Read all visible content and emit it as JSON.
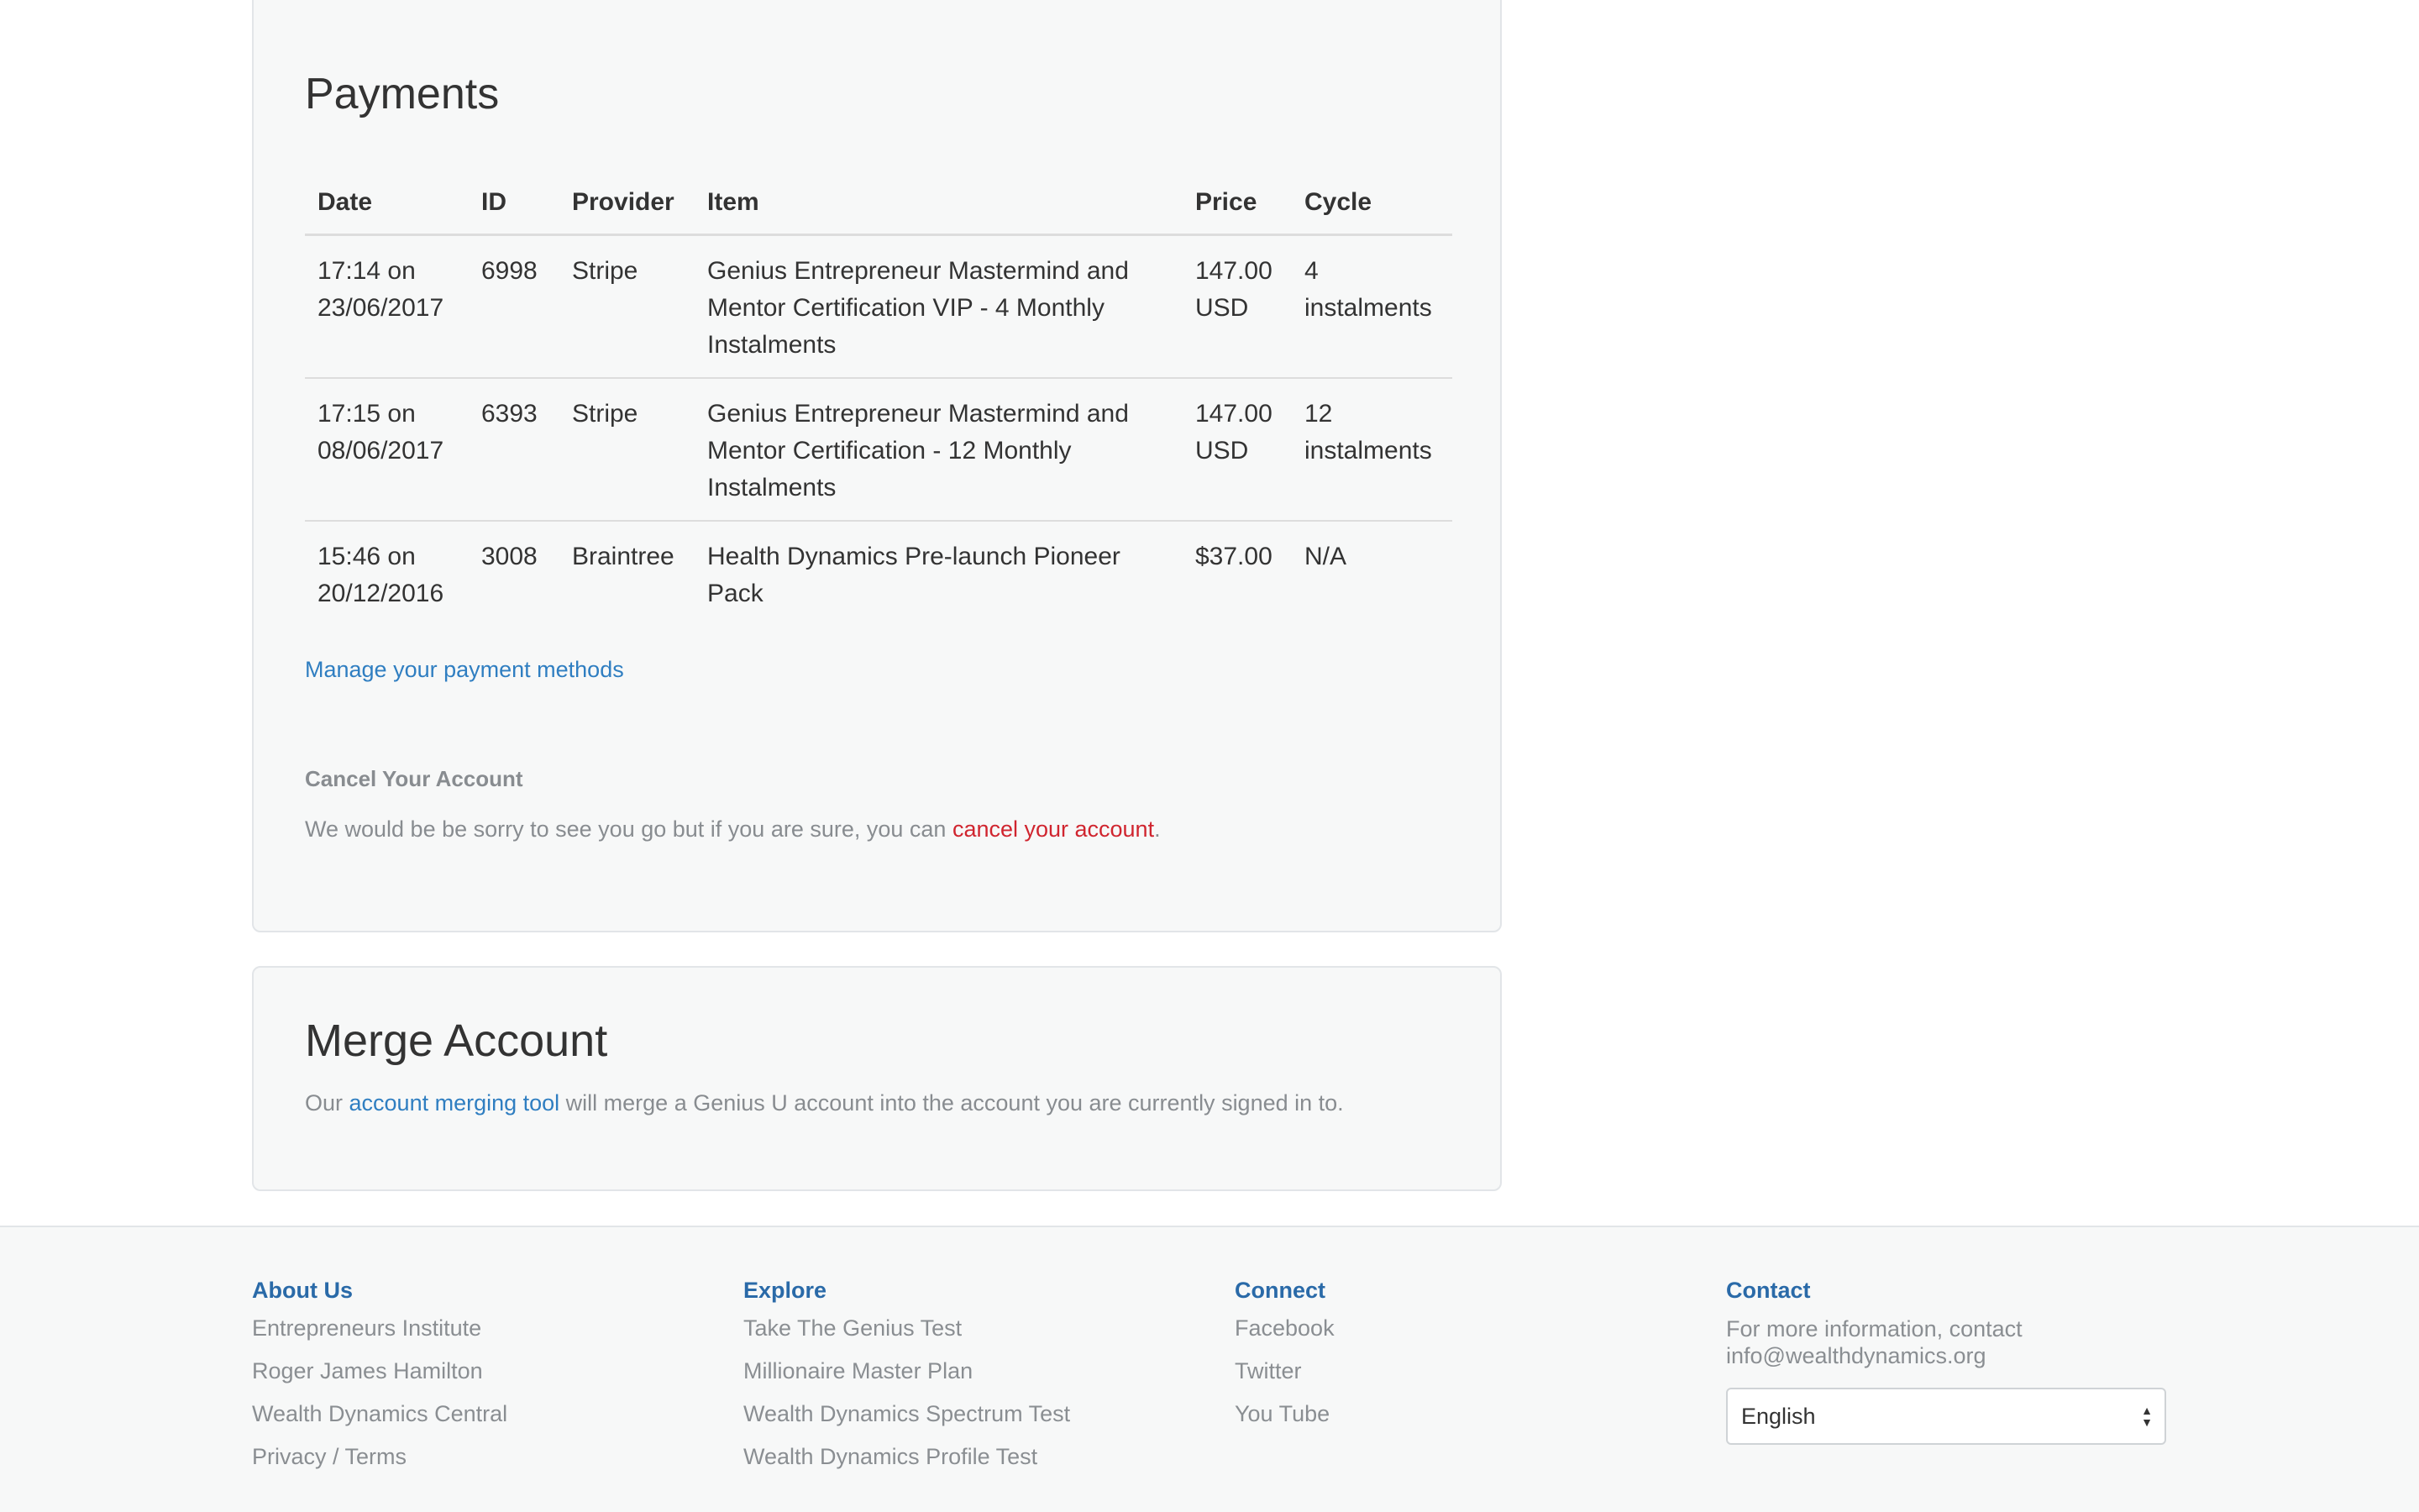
{
  "payments": {
    "title": "Payments",
    "columns": [
      "Date",
      "ID",
      "Provider",
      "Item",
      "Price",
      "Cycle"
    ],
    "rows": [
      {
        "date": "17:14 on 23/06/2017",
        "id": "6998",
        "provider": "Stripe",
        "item": "Genius Entrepreneur Mastermind and Mentor Certification VIP - 4 Monthly Instalments",
        "price": "147.00 USD",
        "cycle": "4 instalments"
      },
      {
        "date": "17:15 on 08/06/2017",
        "id": "6393",
        "provider": "Stripe",
        "item": "Genius Entrepreneur Mastermind and Mentor Certification - 12 Monthly Instalments",
        "price": "147.00 USD",
        "cycle": "12 instalments"
      },
      {
        "date": "15:46 on 20/12/2016",
        "id": "3008",
        "provider": "Braintree",
        "item": "Health Dynamics Pre-launch Pioneer Pack",
        "price": "$37.00",
        "cycle": "N/A"
      }
    ],
    "manage_link": "Manage your payment methods"
  },
  "cancel": {
    "heading": "Cancel Your Account",
    "text_before": "We would be be sorry to see you go but if you are sure, you can ",
    "link": "cancel your account",
    "text_after": "."
  },
  "merge": {
    "title": "Merge Account",
    "text_before": "Our ",
    "link": "account merging tool",
    "text_after": " will merge a Genius U account into the account you are currently signed in to."
  },
  "footer": {
    "about": {
      "heading": "About Us",
      "links": [
        "Entrepreneurs Institute",
        "Roger James Hamilton",
        "Wealth Dynamics Central",
        "Privacy / Terms"
      ]
    },
    "explore": {
      "heading": "Explore",
      "links": [
        "Take The Genius Test",
        "Millionaire Master Plan",
        "Wealth Dynamics Spectrum Test",
        "Wealth Dynamics Profile Test"
      ]
    },
    "connect": {
      "heading": "Connect",
      "links": [
        "Facebook",
        "Twitter",
        "You Tube"
      ]
    },
    "contact": {
      "heading": "Contact",
      "text": "For more information, contact info@wealthdynamics.org",
      "language": "English"
    }
  },
  "colors": {
    "accent": "#2f7ec1",
    "danger": "#d0252f",
    "muted": "#888c90",
    "footer_heading": "#2a6aa8"
  }
}
